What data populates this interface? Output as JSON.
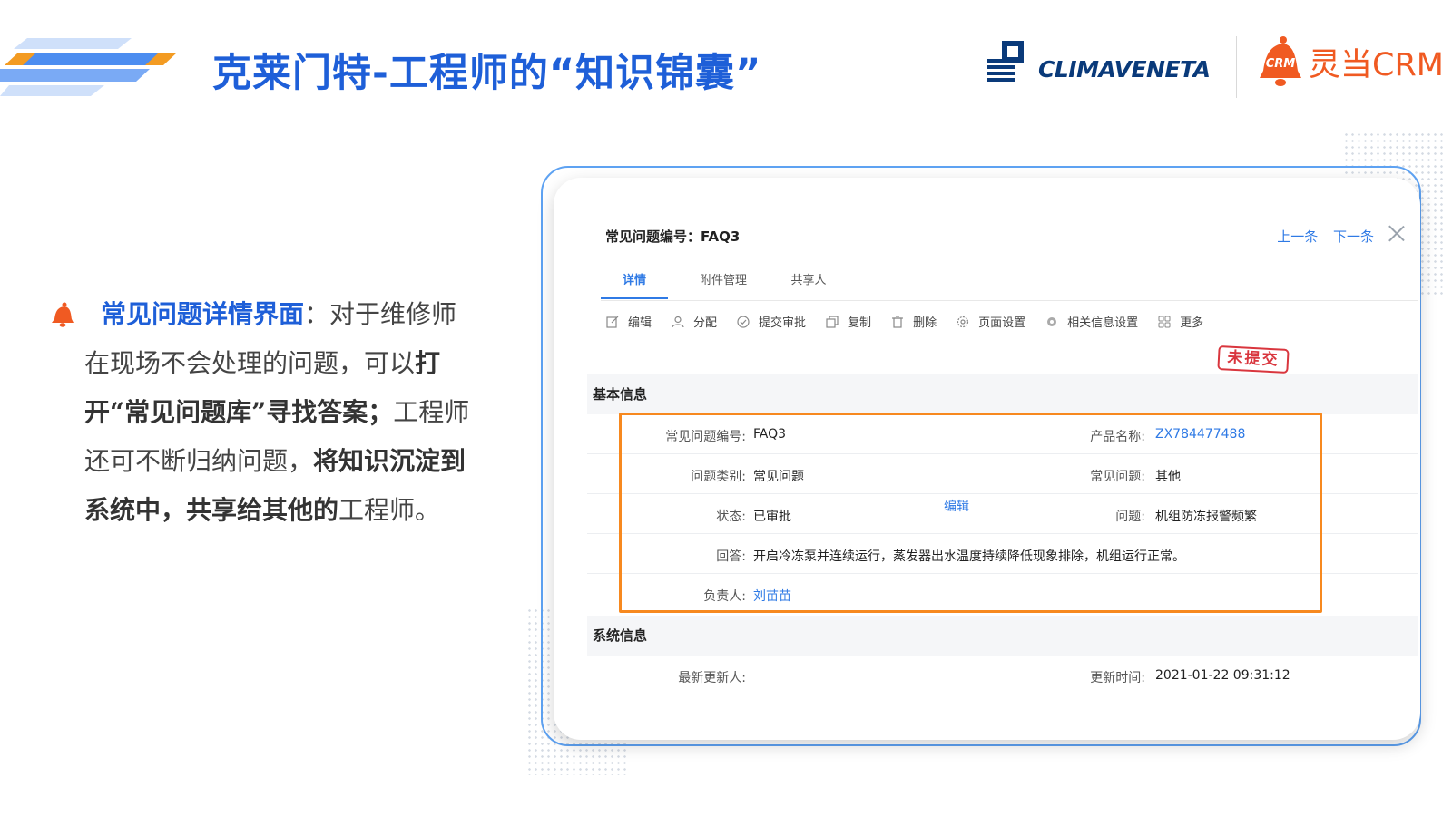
{
  "header": {
    "title": "克莱门特-工程师的“知识锦囊”",
    "brand1": "CLIMAVENETA",
    "brand2_mark": "CRM",
    "brand2": "灵当CRM",
    "colors": {
      "title": "#1e5fd8",
      "stripe_blue": "#4c8df0",
      "stripe_orange": "#f39b22",
      "crm_orange": "#f05a22"
    }
  },
  "bullet": {
    "icon": "crm-bell-icon",
    "heading": "常见问题详情界面",
    "colon": "：",
    "text_1": "对于维修师在现场不会处理的问题，可以",
    "text_bold_1": "打开“常见问题库”寻找答案；",
    "text_2": "工程师还可不断归纳问题，",
    "text_bold_2": "将知识沉淀到系统中，共享给其他的",
    "text_3": "工程师。"
  },
  "panel": {
    "title": "常见问题编号：FAQ3",
    "nav_prev": "上一条",
    "nav_next": "下一条",
    "tabs": [
      "详情",
      "附件管理",
      "共享人"
    ],
    "toolbar": [
      {
        "label": "编辑",
        "icon": "edit-icon"
      },
      {
        "label": "分配",
        "icon": "user-icon"
      },
      {
        "label": "提交审批",
        "icon": "check-circle-icon"
      },
      {
        "label": "复制",
        "icon": "copy-icon"
      },
      {
        "label": "删除",
        "icon": "trash-icon"
      },
      {
        "label": "页面设置",
        "icon": "gear-icon"
      },
      {
        "label": "相关信息设置",
        "icon": "settings-icon"
      },
      {
        "label": "更多",
        "icon": "grid-icon"
      }
    ],
    "stamp": "未提交",
    "basic_section": "基本信息",
    "fields": {
      "faq_no_label": "常见问题编号:",
      "faq_no": "FAQ3",
      "product_label": "产品名称:",
      "product": "ZX784477488",
      "category_label": "问题类别:",
      "category": "常见问题",
      "common_label": "常见问题:",
      "common": "其他",
      "status_label": "状态:",
      "status": "已审批",
      "edit_link": "编辑",
      "question_label": "问题:",
      "question": "机组防冻报警频繁",
      "answer_label": "回答:",
      "answer": "开启冷冻泵并连续运行，蒸发器出水温度持续降低现象排除，机组运行正常。",
      "owner_label": "负责人:",
      "owner": "刘苗苗"
    },
    "system_section": "系统信息",
    "system": {
      "updater_label": "最新更新人:",
      "updater": "",
      "time_label": "更新时间:",
      "time": "2021-01-22 09:31:12"
    },
    "highlight_color": "#f7891f"
  }
}
